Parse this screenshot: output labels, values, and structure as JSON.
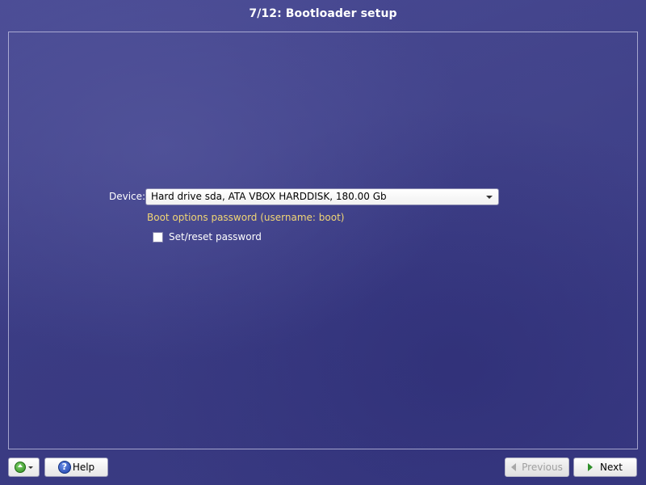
{
  "header": {
    "title": "7/12: Bootloader setup"
  },
  "form": {
    "device_label": "Device:",
    "device_value": "Hard drive sda, ATA VBOX HARDDISK, 180.00 Gb",
    "boot_password_label": "Boot options password (username: boot)",
    "set_password_label": "Set/reset password",
    "set_password_checked": false
  },
  "footer": {
    "advanced_icon": "green-up-circle-icon",
    "help_label": "Help",
    "help_icon": "question-circle-icon",
    "help_icon_glyph": "?",
    "previous_label": "Previous",
    "previous_enabled": false,
    "next_label": "Next"
  },
  "colors": {
    "background": "#3e3f8a",
    "accent_yellow": "#f1d675",
    "next_arrow": "#2f8f2a"
  }
}
